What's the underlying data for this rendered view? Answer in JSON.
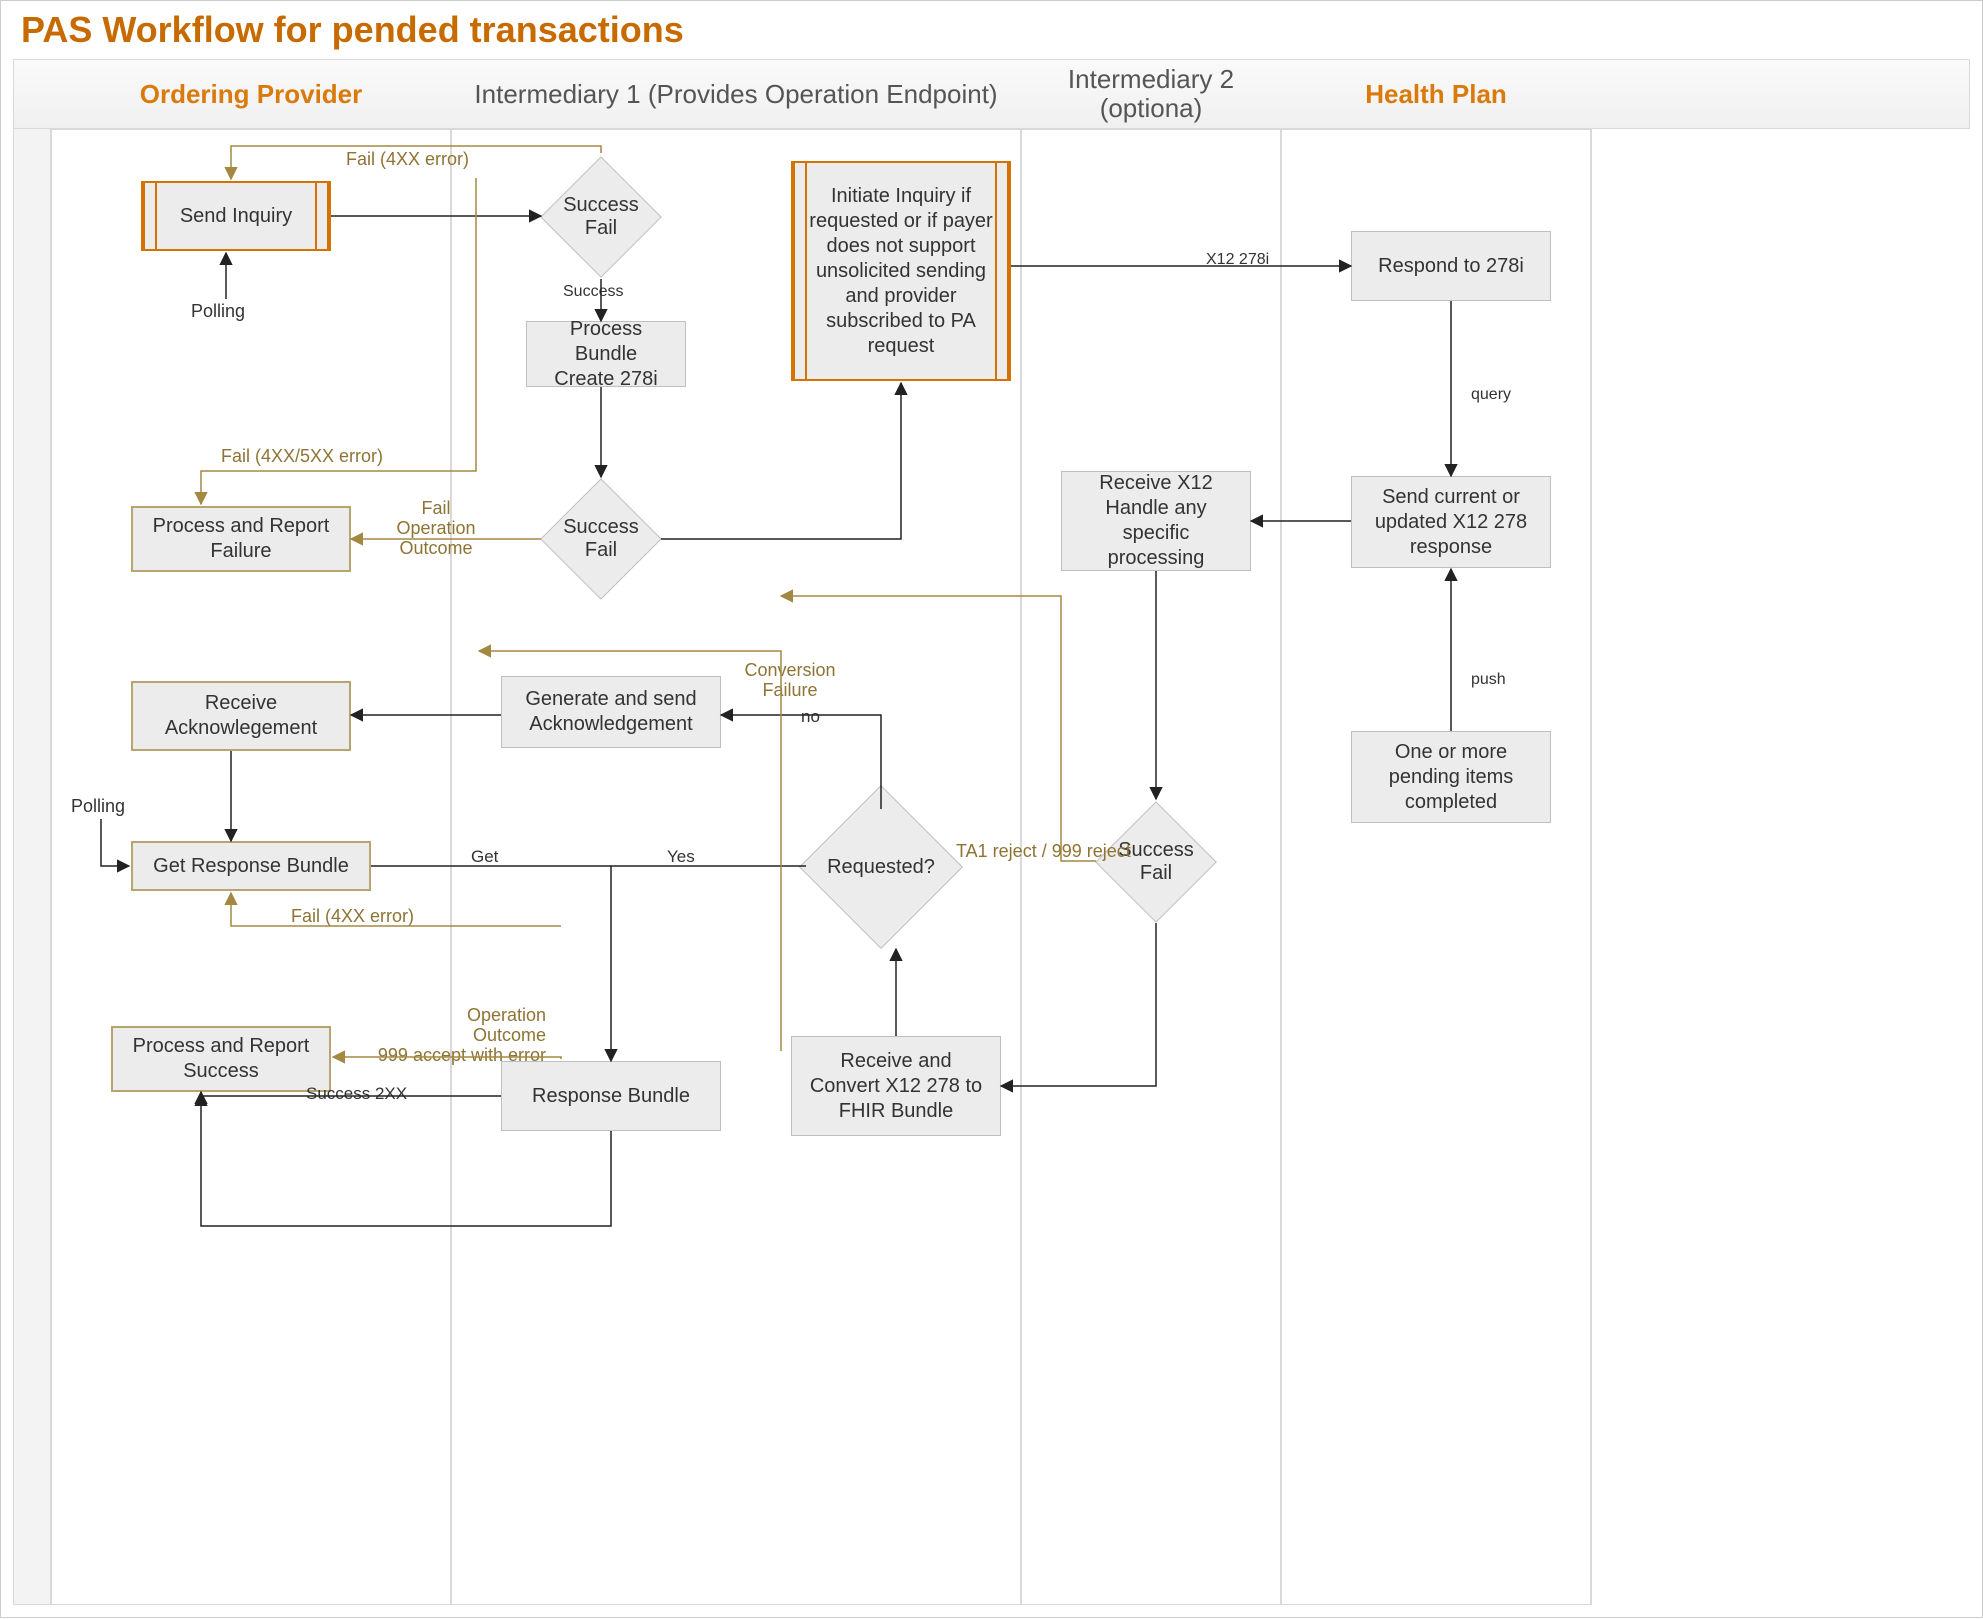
{
  "title": "PAS Workflow for pended transactions",
  "lanes": {
    "ordering": {
      "label": "Ordering Provider"
    },
    "intermediary1": {
      "label": "Intermediary 1 (Provides Operation Endpoint)"
    },
    "intermediary2": {
      "label": "Intermediary 2 (optiona)"
    },
    "healthplan": {
      "label": "Health Plan"
    }
  },
  "nodes": {
    "polling_top": "Polling",
    "send_inquiry": "Send Inquiry",
    "success_fail_top": "Success\nFail",
    "process_bundle_278i": "Process Bundle\nCreate 278i",
    "success_fail_mid": "Success\nFail",
    "initiate_inquiry": "Initiate Inquiry if requested or if payer does not support unsolicited sending and provider subscribed to PA request",
    "process_report_failure": "Process and Report\nFailure",
    "receive_ack": "Receive\nAcknowlegement",
    "get_response_bundle": "Get Response Bundle",
    "process_report_success": "Process and Report\nSuccess",
    "generate_send_ack": "Generate and send\nAcknowledgement",
    "requested": "Requested?",
    "response_bundle": "Response Bundle",
    "receive_convert": "Receive and\nConvert X12 278 to\nFHIR Bundle",
    "receive_x12_handle": "Receive X12\nHandle any\nspecific processing",
    "success_fail_i2": "Success\nFail",
    "respond_to_278i": "Respond to 278i",
    "send_current_updated": "Send current or\nupdated X12 278\nresponse",
    "pending_completed": "One or more\npending items\ncompleted",
    "polling_bottom": "Polling"
  },
  "edges": {
    "fail_4xx_top": "Fail (4XX error)",
    "success_small": "Success",
    "fail_4xx5xx": "Fail (4XX/5XX error)",
    "fail_op_outcome": "Fail\nOperation\nOutcome",
    "x12_278i": "X12 278i",
    "query": "query",
    "push": "push",
    "conversion_failure": "Conversion\nFailure",
    "ta1_999_reject": "TA1 reject / 999 reject",
    "no": "no",
    "yes": "Yes",
    "get": "Get",
    "fail_4xx_bottom": "Fail (4XX error)",
    "op_outcome_999": "Operation\nOutcome\n999 accept with error",
    "success_2xx": "Success 2XX",
    "response_bundle_edge": "Response Bundle"
  }
}
